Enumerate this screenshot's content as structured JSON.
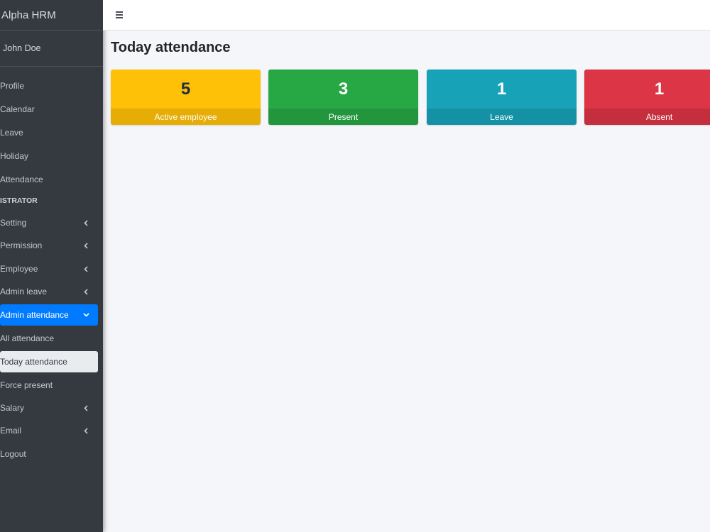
{
  "brand": {
    "title": "Alpha HRM"
  },
  "user": {
    "name": "John Doe"
  },
  "sidebar": {
    "items": [
      {
        "label": "Profile"
      },
      {
        "label": "Calendar"
      },
      {
        "label": "Leave"
      },
      {
        "label": "Holiday"
      },
      {
        "label": "Attendance"
      }
    ],
    "header": "ISTRATOR",
    "admin_items": [
      {
        "label": "Setting"
      },
      {
        "label": "Permission"
      },
      {
        "label": "Employee"
      },
      {
        "label": "Admin leave"
      },
      {
        "label": "Admin attendance"
      },
      {
        "label": "All attendance"
      },
      {
        "label": "Today attendance"
      },
      {
        "label": "Force present"
      },
      {
        "label": "Salary"
      },
      {
        "label": "Email"
      },
      {
        "label": "Logout"
      }
    ]
  },
  "page": {
    "title": "Today attendance"
  },
  "cards": [
    {
      "value": "5",
      "label": "Active employee",
      "color": "#ffc107"
    },
    {
      "value": "3",
      "label": "Present",
      "color": "#28a745"
    },
    {
      "value": "1",
      "label": "Leave",
      "color": "#17a2b8"
    },
    {
      "value": "1",
      "label": "Absent",
      "color": "#dc3545"
    }
  ],
  "icons": {
    "menu": "hamburger-icon",
    "collapsed": "chevron-left-icon",
    "expanded": "chevron-down-icon"
  }
}
